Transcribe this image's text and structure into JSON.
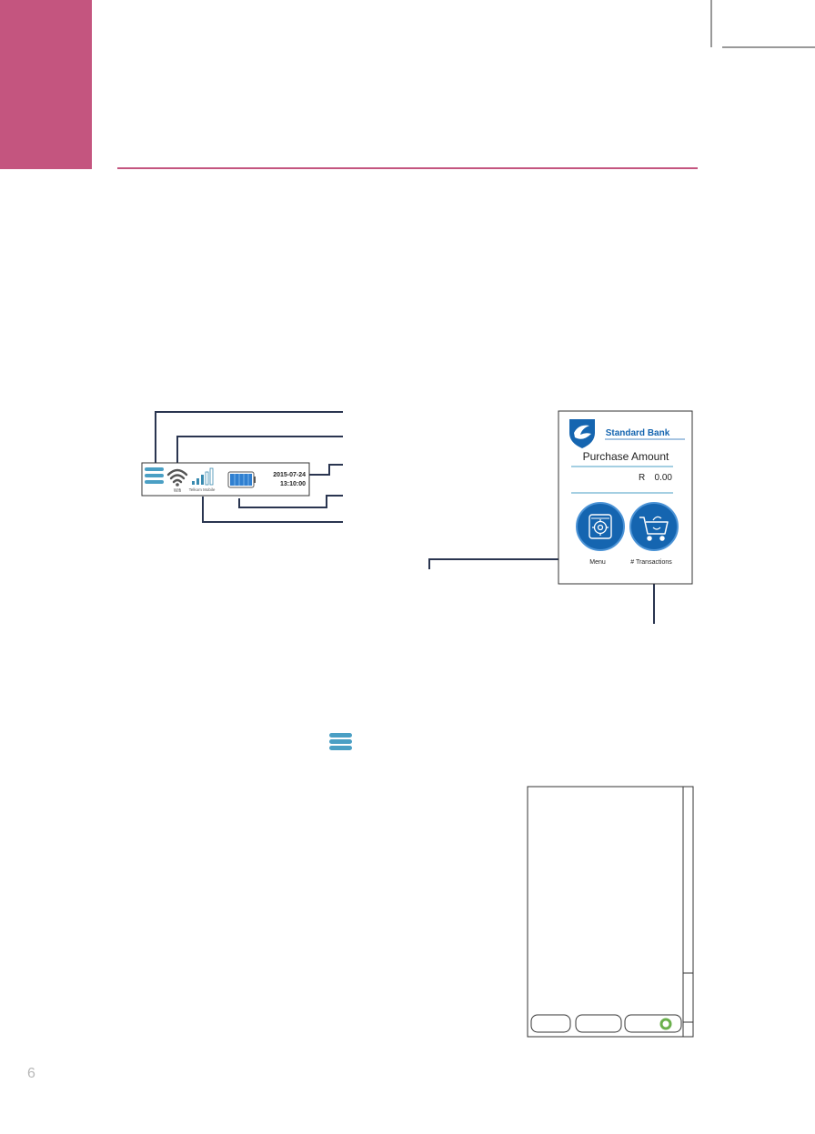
{
  "page": {
    "number": "6"
  },
  "colors": {
    "accent": "#c4557f",
    "leader_line": "#2a3550",
    "bank_blue": "#1565b0",
    "menu_icon": "#4a9fc4",
    "ok_green": "#6ab04c"
  },
  "status_bar": {
    "wifi_label": "Wifi",
    "carrier_label": "Telkom Mobile",
    "date": "2015-07-24",
    "time": "13:10:00",
    "icons": [
      "menu-icon",
      "wifi-icon",
      "signal-icon",
      "battery-icon"
    ]
  },
  "terminal_screen": {
    "brand": "Standard Bank",
    "amount_label": "Purchase Amount",
    "currency": "R",
    "amount": "0.00",
    "menu_label": "Menu",
    "transactions_label": "# Transactions",
    "icons": [
      "standard-bank-shield-icon",
      "settings-gear-icon",
      "shopping-cart-icon"
    ]
  },
  "menu_screen": {
    "buttons": [
      "",
      "",
      ""
    ],
    "ok_icon": "ring-icon"
  }
}
